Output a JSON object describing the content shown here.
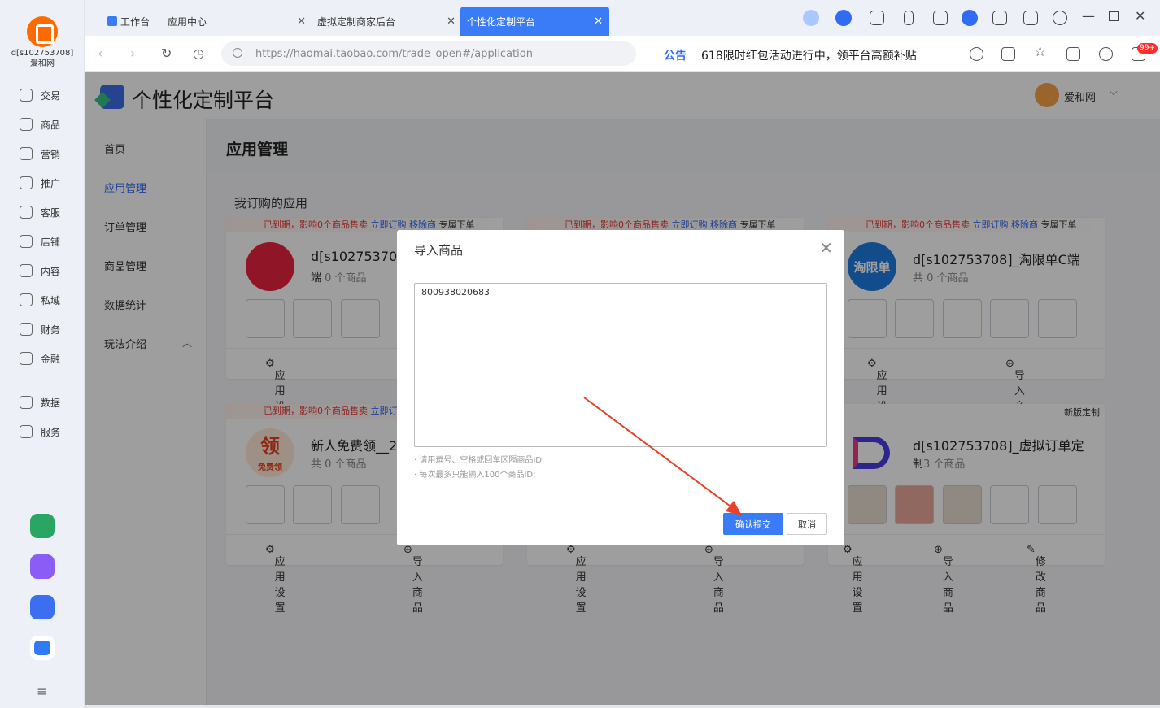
{
  "user": {
    "id": "d[s102753708]",
    "shop": "爱和网"
  },
  "nav": [
    "交易",
    "商品",
    "营销",
    "推广",
    "客服",
    "店铺",
    "内容",
    "私域",
    "财务",
    "金融"
  ],
  "nav2": [
    "数据",
    "服务"
  ],
  "tabs": {
    "workbench": "工作台",
    "app_center": "应用中心",
    "merchant": "虚拟定制商家后台",
    "platform": "个性化定制平台"
  },
  "url": "https://haomai.taobao.com/trade_open#/application",
  "announce": {
    "label": "公告",
    "text": "618限时红包活动进行中，领平台高额补贴"
  },
  "badge": "99+",
  "brand": "个性化定制平台",
  "account": "爱和网",
  "sidenav": {
    "home": "首页",
    "apps": "应用管理",
    "orders": "订单管理",
    "goods": "商品管理",
    "stats": "数据统计",
    "play": "玩法介绍"
  },
  "page_title": "应用管理",
  "section_title": "我订购的应用",
  "banner": {
    "expired": "已到期，影响0个商品售卖",
    "renew": "立即订购",
    "remove": "移除商",
    "exclusive": "专属下单",
    "remove2": "移除商"
  },
  "cards": {
    "c1": {
      "name": "d[s102753708]_",
      "name2": "端",
      "count_pre": "0 个商品"
    },
    "c3": {
      "name": "d[s102753708]_淘限单C端",
      "count": "共 0 个商品",
      "logo": "淘限单"
    },
    "c4": {
      "name": "新人免费领__2",
      "count": "共 0 个商品",
      "logo": "领",
      "logo_sub": "免费领"
    },
    "c6": {
      "name": "d[s102753708]_虚拟订单定",
      "name2": "制",
      "count": "3 个商品",
      "tag": "新版定制"
    }
  },
  "foot": {
    "settings": "应用设置",
    "import": "导入商品",
    "edit": "修改商品"
  },
  "dialog": {
    "title": "导入商品",
    "value": "800938020683",
    "hint1": "· 请用逗号、空格或回车区隔商品ID;",
    "hint2": "· 每次最多只能输入100个商品ID;",
    "ok": "确认提交",
    "cancel": "取消"
  },
  "colors": {
    "accent": "#3a7bf7",
    "warn": "#e23b3b",
    "arrow": "#e8402a"
  }
}
